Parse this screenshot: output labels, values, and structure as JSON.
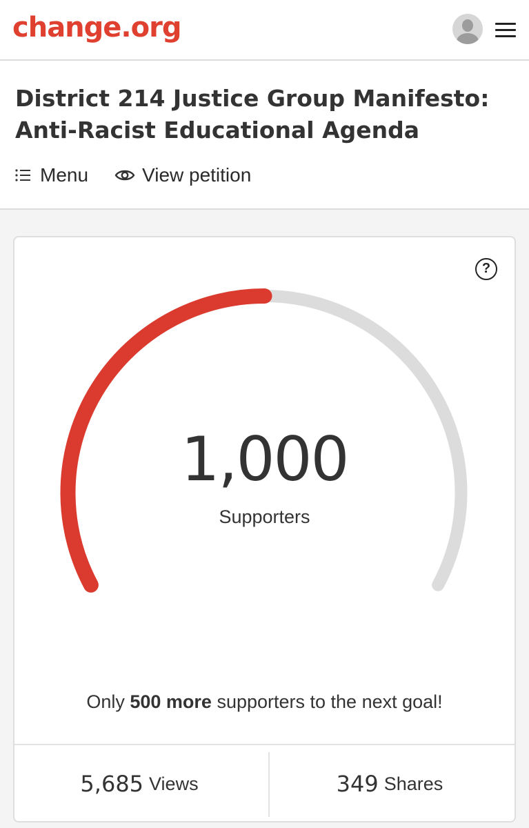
{
  "header": {
    "logo_text": "change.org",
    "brand_color": "#e0402f"
  },
  "petition": {
    "title": "District 214 Justice Group Manifesto: Anti-Racist Educational Agenda",
    "nav": {
      "menu_label": "Menu",
      "view_petition_label": "View petition"
    }
  },
  "gauge": {
    "count": "1,000",
    "count_label": "Supporters",
    "progress_fraction": 0.5,
    "fill_color": "#db3b2e",
    "track_color": "#dcdcdc",
    "help_glyph": "?"
  },
  "goal": {
    "prefix": "Only",
    "highlight": "500 more",
    "suffix": "supporters to the next goal!"
  },
  "stats": {
    "views_value": "5,685",
    "views_label": "Views",
    "shares_value": "349",
    "shares_label": "Shares"
  },
  "icons": {
    "help": "question-circle-icon",
    "menu_list": "list-icon",
    "view": "eye-icon",
    "hamburger": "hamburger-icon",
    "avatar": "user-avatar"
  }
}
